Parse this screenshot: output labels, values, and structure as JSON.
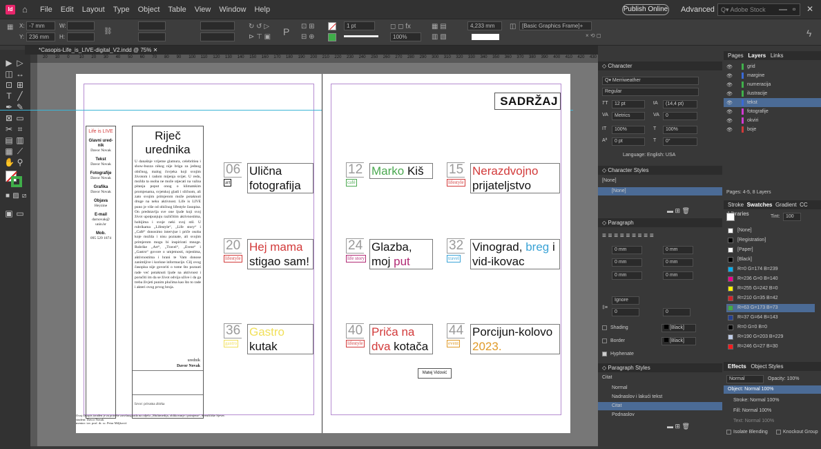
{
  "menubar": {
    "items": [
      "File",
      "Edit",
      "Layout",
      "Type",
      "Object",
      "Table",
      "View",
      "Window",
      "Help"
    ],
    "publish": "Publish Online",
    "workspace": "Advanced",
    "stock_placeholder": "Adobe Stock"
  },
  "control": {
    "x": "-7 mm",
    "y": "236 mm",
    "stroke": "1 pt",
    "measure": "4,233 mm",
    "frame_style": "[Basic Graphics Frame]+",
    "zoom": "100%"
  },
  "document": {
    "tab": "*Casopis-Life_is_LIVE-digital_V2.indd @ 75%",
    "ruler_ticks": [
      "20",
      "10",
      "0",
      "10",
      "20",
      "30",
      "40",
      "50",
      "60",
      "70",
      "80",
      "90",
      "100",
      "110",
      "120",
      "130",
      "140",
      "150",
      "160",
      "170",
      "180",
      "190",
      "200",
      "210",
      "220",
      "230",
      "240",
      "250",
      "260",
      "270",
      "280",
      "290",
      "300",
      "310",
      "320",
      "330",
      "340",
      "350",
      "360",
      "370",
      "380",
      "390",
      "400",
      "410",
      "420",
      "430"
    ]
  },
  "left_page": {
    "sidebar": {
      "logo": "Life is LIVE",
      "items": [
        {
          "role": "Glavni ured-nik",
          "name": "Davor Novak"
        },
        {
          "role": "Tekst",
          "name": "Davor Novak"
        },
        {
          "role": "Fotografije",
          "name": "Davor Novak"
        },
        {
          "role": "Grafika",
          "name": "Davor Novak"
        },
        {
          "role": "Objava",
          "name": "Heyzine"
        },
        {
          "role": "E-mail",
          "name": "darnovak@ unin.hr"
        },
        {
          "role": "Mob.",
          "name": "095 529 1874"
        }
      ]
    },
    "editorial": {
      "title": "Riječ urednika",
      "body": "U današnje vrijeme glamura, celebritiea i show-buzza nikog nije briga za jednog običnog, malog čovjeka koji svojim životom i radom mijenja svijet. U redu, možda ta osoba ne može utjecati na važna pitanja poput onog o klimatskim promjenama, svjetskoj gladi i sličnom, ali zato svojim primjerom može potaknuti druge na neku aktivnost. Life is LIVE puno je više od običnog lifestyle časopisa. On predstavlja sve one ljude koji svoj život upotpunjuju različitim aktivnostima, hobijima i svoje neki svoj stil. U rubrikama „Lifestyle“, „Life story“ i „Café“ donosimo intervjue i priče osoba koje možda i nisu poznate, ali svojim primjerom mogu bi inspirirati mnoge. Rubrike „Art“, „Travel“, „Event“ i „Gastro“ govore o umjetnosti, mjestima, aktivnostima i hrani te Vam donose zanimljive i korisne informacije. Cilj ovog časopisa nije govoriti o tome što poznati rade već potaknuti ljude na aktivnost i poručiti im da se život odvija užive i da ga treba živjeti punim plućima kao što to rade i akteri ovog prvog broja.",
      "signature_role": "urednik",
      "signature_name": "Davor Novak",
      "source": "Izvor: privatna zbirka"
    },
    "footer": [
      "Ovaj časopis izrađen je za potrebe završnog rada na odjelu „Multimedija, oblikovanje i primjena“, Sveučilište Sjever.",
      "student: Davor Novak",
      "mentor: izv. prof. dr. sc. Petar Miljković"
    ]
  },
  "right_page": {
    "header": "SADRŽAJ",
    "toc": [
      {
        "num": "06",
        "tag": "art",
        "tag_color": "#111111",
        "title_parts": [
          {
            "t": "Ulična fotografija",
            "c": "#111111"
          }
        ]
      },
      {
        "num": "12",
        "tag": "café",
        "tag_color": "#4aa84f",
        "title_parts": [
          {
            "t": "Marko ",
            "c": "#4aa84f"
          },
          {
            "t": "Kiš",
            "c": "#111111"
          }
        ]
      },
      {
        "num": "15",
        "tag": "lifestyle",
        "tag_color": "#d23a3a",
        "title_parts": [
          {
            "t": "Nerazdvojno ",
            "c": "#d23a3a"
          },
          {
            "t": "prijateljstvo",
            "c": "#111111"
          }
        ]
      },
      {
        "num": "20",
        "tag": "lifestyle",
        "tag_color": "#d23a3a",
        "title_parts": [
          {
            "t": "Hej mama ",
            "c": "#d23a3a"
          },
          {
            "t": "stigao sam!",
            "c": "#111111"
          }
        ]
      },
      {
        "num": "24",
        "tag": "life story",
        "tag_color": "#b12a74",
        "title_parts": [
          {
            "t": "Glazba, moj ",
            "c": "#111111"
          },
          {
            "t": "put",
            "c": "#b12a74"
          }
        ]
      },
      {
        "num": "32",
        "tag": "travel",
        "tag_color": "#3aa3d6",
        "title_parts": [
          {
            "t": "Vinograd, ",
            "c": "#111111"
          },
          {
            "t": "breg",
            "c": "#3aa3d6"
          },
          {
            "t": " i vid-ikovac",
            "c": "#111111"
          }
        ]
      },
      {
        "num": "36",
        "tag": "gastro",
        "tag_color": "#f1e05a",
        "title_parts": [
          {
            "t": "Gastro ",
            "c": "#f1e05a"
          },
          {
            "t": "kutak",
            "c": "#111111"
          }
        ]
      },
      {
        "num": "40",
        "tag": "lifestyle",
        "tag_color": "#d23a3a",
        "title_parts": [
          {
            "t": "Priča na ",
            "c": "#d23a3a"
          },
          {
            "t": "dva",
            "c": "#d23a3a"
          },
          {
            "t": " kotača",
            "c": "#111111"
          }
        ]
      },
      {
        "num": "44",
        "tag": "event",
        "tag_color": "#e09a28",
        "title_parts": [
          {
            "t": "Porcijun-kolovo ",
            "c": "#111111"
          },
          {
            "t": "2023.",
            "c": "#e09a28"
          }
        ]
      }
    ],
    "credit": "Matej Vidović"
  },
  "character": {
    "title": "Character",
    "font": "Merriweather",
    "style": "Regular",
    "size": "12 pt",
    "leading": "(14,4 pt)",
    "kerning": "Metrics",
    "tracking": "0",
    "vscale": "100%",
    "hscale": "100%",
    "baseline": "0 pt",
    "skew": "0°",
    "language": "Language: English: USA"
  },
  "character_styles": {
    "title": "Character Styles",
    "current": "[None]",
    "items": [
      "[None]"
    ]
  },
  "paragraph": {
    "title": "Paragraph",
    "values": [
      "0 mm",
      "0 mm",
      "0 mm",
      "0 mm",
      "0 mm",
      "0 mm"
    ],
    "ignore": "Ignore",
    "dropcap": "0",
    "dropcap2": "0",
    "shading": "Shading",
    "border": "Border",
    "shading_color": "[Black]",
    "border_color": "[Black]",
    "hyphenate": "Hyphenate"
  },
  "paragraph_styles": {
    "title": "Paragraph Styles",
    "current": "Citat",
    "items": [
      "Normal",
      "Nadnaslov i lakući tekst",
      "Citat",
      "Podnaslov"
    ]
  },
  "layers": {
    "tabs": [
      "Pages",
      "Layers",
      "Links"
    ],
    "items": [
      {
        "name": "grid",
        "color": "#3fb04a"
      },
      {
        "name": "margine",
        "color": "#3a6ad6"
      },
      {
        "name": "numeracija",
        "color": "#3fb04a"
      },
      {
        "name": "ilustracije",
        "color": "#3fb04a"
      },
      {
        "name": "tekst",
        "color": "#3a6ad6"
      },
      {
        "name": "fotografije",
        "color": "#d23ad2"
      },
      {
        "name": "okviri",
        "color": "#d23ad2"
      },
      {
        "name": "boje",
        "color": "#d23a3a"
      }
    ],
    "footer": "Pages: 4-5, 8 Layers"
  },
  "swatches": {
    "tabs": [
      "Stroke",
      "Swatches",
      "Gradient",
      "CC Libraries"
    ],
    "tint": "100",
    "items": [
      {
        "name": "[None]",
        "color": "#ffffff"
      },
      {
        "name": "[Registration]",
        "color": "#000000"
      },
      {
        "name": "[Paper]",
        "color": "#ffffff"
      },
      {
        "name": "[Black]",
        "color": "#000000"
      },
      {
        "name": "R=0 G=174 B=239",
        "color": "#00aeef"
      },
      {
        "name": "R=236 G=0 B=140",
        "color": "#ec008c"
      },
      {
        "name": "R=255 G=242 B=0",
        "color": "#fff200"
      },
      {
        "name": "R=210 G=35 B=42",
        "color": "#d2232a"
      },
      {
        "name": "R=63 G=173 B=73",
        "color": "#3fad49"
      },
      {
        "name": "R=37 G=64 B=143",
        "color": "#25408f"
      },
      {
        "name": "R=0 G=0 B=0",
        "color": "#000000"
      },
      {
        "name": "R=190 G=203 B=229",
        "color": "#becbe5"
      },
      {
        "name": "R=246 G=27 B=30",
        "color": "#f61b1e"
      }
    ]
  },
  "effects": {
    "tabs": [
      "Effects",
      "Object Styles"
    ],
    "mode": "Normal",
    "opacity": "Opacity: 100%",
    "object": "Object: Normal 100%",
    "stroke": "Stroke: Normal 100%",
    "fill": "Fill: Normal 100%",
    "text": "Text: Normal 100%",
    "isolate": "Isolate Blending",
    "knockout": "Knockout Group"
  }
}
